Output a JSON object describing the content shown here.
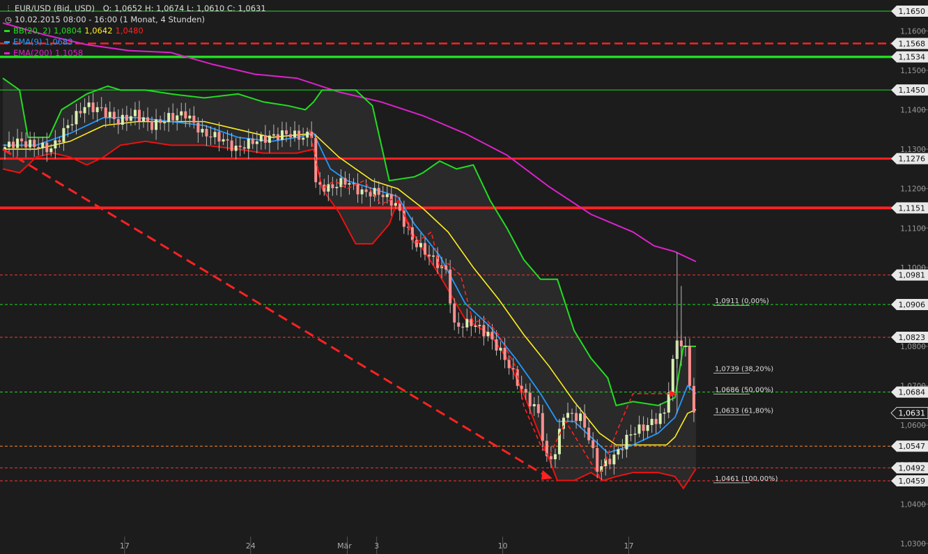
{
  "header": {
    "symbol": "EUR/USD (Bid, USD)",
    "ohlc": "O: 1,0652  H: 1,0674  L: 1,0610  C: 1,0631",
    "period": "10.02.2015 08:00 - 16:00 (1 Monat, 4 Stunden)",
    "indicators": [
      {
        "name": "BB(20, 2)",
        "color": "#22dd22",
        "values": [
          {
            "text": "1,0804",
            "color": "#22dd22"
          },
          {
            "text": "1,0642",
            "color": "#ffee22"
          },
          {
            "text": "1,0480",
            "color": "#ff2222"
          }
        ]
      },
      {
        "name": "EMA(9)",
        "color": "#2299ff",
        "values": [
          {
            "text": "1,0683",
            "color": "#2299ff"
          }
        ]
      },
      {
        "name": "EMA(200)",
        "color": "#dd22cc",
        "values": [
          {
            "text": "1,1058",
            "color": "#dd22cc"
          }
        ]
      }
    ]
  },
  "chart_data": {
    "type": "line",
    "subtype": "candlestick-with-indicators",
    "y_range": [
      1.03,
      1.165
    ],
    "y_ticks": [
      {
        "v": 1.16,
        "label": "1,1600"
      },
      {
        "v": 1.15,
        "label": "1,1500"
      },
      {
        "v": 1.14,
        "label": "1,1400"
      },
      {
        "v": 1.13,
        "label": "1,1300"
      },
      {
        "v": 1.12,
        "label": "1,1200"
      },
      {
        "v": 1.11,
        "label": "1,1100"
      },
      {
        "v": 1.1,
        "label": "1,1000"
      },
      {
        "v": 1.09,
        "label": "1,0900"
      },
      {
        "v": 1.08,
        "label": "1,0800"
      },
      {
        "v": 1.07,
        "label": "1,0700"
      },
      {
        "v": 1.06,
        "label": "1,0600"
      },
      {
        "v": 1.05,
        "label": "1,0500"
      },
      {
        "v": 1.04,
        "label": "1,0400"
      },
      {
        "v": 1.03,
        "label": "1,0300"
      }
    ],
    "x_ticks": [
      {
        "i": 29,
        "label": "17"
      },
      {
        "i": 59,
        "label": "24"
      },
      {
        "i": 82,
        "label": "Mär"
      },
      {
        "i": 89,
        "label": "3"
      },
      {
        "i": 119,
        "label": "10"
      },
      {
        "i": 149,
        "label": "17"
      }
    ],
    "n_bars": 165,
    "levels": [
      {
        "v": 1.165,
        "label": "1,1650",
        "color": "#22dd22",
        "style": "solid",
        "width": 1
      },
      {
        "v": 1.1568,
        "label": "1,1568",
        "color": "#ff2222",
        "style": "dash",
        "width": 2.5
      },
      {
        "v": 1.1534,
        "label": "1,1534",
        "color": "#22dd22",
        "style": "solid",
        "width": 3.5
      },
      {
        "v": 1.145,
        "label": "1,1450",
        "color": "#22dd22",
        "style": "solid",
        "width": 1
      },
      {
        "v": 1.1276,
        "label": "1,1276",
        "color": "#ff2222",
        "style": "solid",
        "width": 3
      },
      {
        "v": 1.1151,
        "label": "1,1151",
        "color": "#ff2222",
        "style": "solid",
        "width": 4
      },
      {
        "v": 1.0981,
        "label": "1,0981",
        "color": "#ff3333",
        "style": "dot",
        "width": 1
      },
      {
        "v": 1.0906,
        "label": "1,0906",
        "color": "#22dd22",
        "style": "dot",
        "width": 1
      },
      {
        "v": 1.0823,
        "label": "1,0823",
        "color": "#ff3333",
        "style": "dot",
        "width": 1
      },
      {
        "v": 1.0684,
        "label": "1,0684",
        "color": "#22dd22",
        "style": "dot",
        "width": 1
      },
      {
        "v": 1.0631,
        "label": "1,0631",
        "color": "#ffffff",
        "style": "none",
        "width": 0
      },
      {
        "v": 1.0547,
        "label": "1,0547",
        "color": "#ff8833",
        "style": "dot",
        "width": 1
      },
      {
        "v": 1.0492,
        "label": "1,0492",
        "color": "#ff3333",
        "style": "dot",
        "width": 1
      },
      {
        "v": 1.0459,
        "label": "1,0459",
        "color": "#ff3333",
        "style": "dot",
        "width": 1
      }
    ],
    "fib": [
      {
        "v": 1.0911,
        "label": "1,0911 (0,00%)"
      },
      {
        "v": 1.0739,
        "label": "1,0739 (38,20%)"
      },
      {
        "v": 1.0686,
        "label": "1,0686 (50,00%)"
      },
      {
        "v": 1.0633,
        "label": "1,0633 (61,80%)"
      },
      {
        "v": 1.0461,
        "label": "1,0461 (100,00%)"
      }
    ],
    "close": [
      [
        0,
        1.13
      ],
      [
        4,
        1.132
      ],
      [
        8,
        1.131
      ],
      [
        12,
        1.13
      ],
      [
        16,
        1.136
      ],
      [
        20,
        1.141
      ],
      [
        24,
        1.14
      ],
      [
        28,
        1.137
      ],
      [
        32,
        1.139
      ],
      [
        36,
        1.136
      ],
      [
        40,
        1.138
      ],
      [
        44,
        1.139
      ],
      [
        48,
        1.134
      ],
      [
        52,
        1.133
      ],
      [
        56,
        1.13
      ],
      [
        60,
        1.132
      ],
      [
        64,
        1.133
      ],
      [
        68,
        1.134
      ],
      [
        72,
        1.133
      ],
      [
        74,
        1.134
      ],
      [
        75,
        1.121
      ],
      [
        78,
        1.12
      ],
      [
        82,
        1.122
      ],
      [
        86,
        1.119
      ],
      [
        90,
        1.119
      ],
      [
        94,
        1.116
      ],
      [
        98,
        1.107
      ],
      [
        102,
        1.103
      ],
      [
        106,
        1.099
      ],
      [
        108,
        1.085
      ],
      [
        112,
        1.086
      ],
      [
        116,
        1.083
      ],
      [
        120,
        1.077
      ],
      [
        124,
        1.069
      ],
      [
        128,
        1.063
      ],
      [
        130,
        1.051
      ],
      [
        132,
        1.053
      ],
      [
        134,
        1.063
      ],
      [
        138,
        1.062
      ],
      [
        140,
        1.057
      ],
      [
        142,
        1.049
      ],
      [
        146,
        1.052
      ],
      [
        150,
        1.058
      ],
      [
        154,
        1.06
      ],
      [
        158,
        1.063
      ],
      [
        161,
        1.082
      ],
      [
        163,
        1.079
      ],
      [
        165,
        1.063
      ]
    ],
    "ema9": [
      [
        0,
        1.131
      ],
      [
        8,
        1.131
      ],
      [
        16,
        1.134
      ],
      [
        24,
        1.138
      ],
      [
        32,
        1.138
      ],
      [
        40,
        1.137
      ],
      [
        48,
        1.136
      ],
      [
        56,
        1.133
      ],
      [
        64,
        1.132
      ],
      [
        70,
        1.133
      ],
      [
        74,
        1.134
      ],
      [
        78,
        1.125
      ],
      [
        82,
        1.122
      ],
      [
        88,
        1.12
      ],
      [
        94,
        1.118
      ],
      [
        98,
        1.111
      ],
      [
        104,
        1.103
      ],
      [
        110,
        1.091
      ],
      [
        116,
        1.085
      ],
      [
        122,
        1.077
      ],
      [
        128,
        1.068
      ],
      [
        132,
        1.061
      ],
      [
        136,
        1.061
      ],
      [
        140,
        1.057
      ],
      [
        144,
        1.053
      ],
      [
        150,
        1.055
      ],
      [
        156,
        1.058
      ],
      [
        160,
        1.062
      ],
      [
        163,
        1.07
      ],
      [
        165,
        1.068
      ]
    ],
    "bb_mid": [
      [
        0,
        1.13
      ],
      [
        8,
        1.13
      ],
      [
        16,
        1.132
      ],
      [
        24,
        1.136
      ],
      [
        32,
        1.137
      ],
      [
        40,
        1.137
      ],
      [
        48,
        1.137
      ],
      [
        56,
        1.135
      ],
      [
        64,
        1.133
      ],
      [
        74,
        1.134
      ],
      [
        80,
        1.128
      ],
      [
        88,
        1.122
      ],
      [
        94,
        1.12
      ],
      [
        100,
        1.115
      ],
      [
        106,
        1.109
      ],
      [
        112,
        1.1
      ],
      [
        118,
        1.092
      ],
      [
        124,
        1.083
      ],
      [
        130,
        1.075
      ],
      [
        136,
        1.066
      ],
      [
        142,
        1.058
      ],
      [
        146,
        1.055
      ],
      [
        152,
        1.055
      ],
      [
        158,
        1.055
      ],
      [
        160,
        1.057
      ],
      [
        163,
        1.063
      ],
      [
        165,
        1.064
      ]
    ],
    "bb_up": [
      [
        0,
        1.148
      ],
      [
        4,
        1.145
      ],
      [
        6,
        1.133
      ],
      [
        8,
        1.133
      ],
      [
        11,
        1.133
      ],
      [
        14,
        1.14
      ],
      [
        20,
        1.144
      ],
      [
        25,
        1.146
      ],
      [
        28,
        1.145
      ],
      [
        34,
        1.145
      ],
      [
        40,
        1.144
      ],
      [
        48,
        1.143
      ],
      [
        56,
        1.144
      ],
      [
        62,
        1.142
      ],
      [
        68,
        1.141
      ],
      [
        72,
        1.14
      ],
      [
        74,
        1.142
      ],
      [
        76,
        1.145
      ],
      [
        80,
        1.145
      ],
      [
        84,
        1.145
      ],
      [
        88,
        1.141
      ],
      [
        92,
        1.122
      ],
      [
        98,
        1.123
      ],
      [
        100,
        1.124
      ],
      [
        104,
        1.127
      ],
      [
        108,
        1.125
      ],
      [
        112,
        1.126
      ],
      [
        116,
        1.117
      ],
      [
        120,
        1.11
      ],
      [
        124,
        1.102
      ],
      [
        128,
        1.097
      ],
      [
        132,
        1.097
      ],
      [
        136,
        1.084
      ],
      [
        140,
        1.077
      ],
      [
        144,
        1.072
      ],
      [
        146,
        1.065
      ],
      [
        150,
        1.066
      ],
      [
        156,
        1.065
      ],
      [
        160,
        1.067
      ],
      [
        162,
        1.08
      ],
      [
        165,
        1.08
      ]
    ],
    "bb_lo": [
      [
        0,
        1.125
      ],
      [
        4,
        1.124
      ],
      [
        8,
        1.128
      ],
      [
        12,
        1.129
      ],
      [
        16,
        1.128
      ],
      [
        20,
        1.126
      ],
      [
        24,
        1.128
      ],
      [
        28,
        1.131
      ],
      [
        34,
        1.132
      ],
      [
        40,
        1.131
      ],
      [
        48,
        1.131
      ],
      [
        56,
        1.13
      ],
      [
        62,
        1.129
      ],
      [
        70,
        1.129
      ],
      [
        74,
        1.13
      ],
      [
        76,
        1.12
      ],
      [
        80,
        1.114
      ],
      [
        84,
        1.106
      ],
      [
        88,
        1.106
      ],
      [
        92,
        1.111
      ],
      [
        94,
        1.117
      ],
      [
        98,
        1.108
      ],
      [
        104,
        1.098
      ],
      [
        110,
        1.087
      ],
      [
        116,
        1.083
      ],
      [
        120,
        1.077
      ],
      [
        124,
        1.068
      ],
      [
        128,
        1.057
      ],
      [
        132,
        1.046
      ],
      [
        136,
        1.046
      ],
      [
        140,
        1.048
      ],
      [
        143,
        1.046
      ],
      [
        146,
        1.047
      ],
      [
        150,
        1.048
      ],
      [
        156,
        1.048
      ],
      [
        160,
        1.047
      ],
      [
        162,
        1.044
      ],
      [
        165,
        1.049
      ]
    ],
    "ema200": [
      [
        0,
        1.162
      ],
      [
        10,
        1.159
      ],
      [
        20,
        1.1565
      ],
      [
        30,
        1.155
      ],
      [
        40,
        1.1545
      ],
      [
        50,
        1.1515
      ],
      [
        60,
        1.149
      ],
      [
        70,
        1.148
      ],
      [
        80,
        1.1445
      ],
      [
        90,
        1.142
      ],
      [
        100,
        1.1385
      ],
      [
        110,
        1.134
      ],
      [
        120,
        1.1285
      ],
      [
        130,
        1.1205
      ],
      [
        140,
        1.1135
      ],
      [
        150,
        1.109
      ],
      [
        155,
        1.1055
      ],
      [
        160,
        1.104
      ],
      [
        165,
        1.1015
      ]
    ],
    "red_dash": [
      [
        0,
        1.13
      ],
      [
        130,
        1.0467
      ]
    ],
    "zigzag": [
      [
        73,
        1.135
      ],
      [
        76,
        1.12
      ],
      [
        79,
        1.122
      ],
      [
        82,
        1.12
      ],
      [
        86,
        1.122
      ],
      [
        90,
        1.116
      ],
      [
        94,
        1.118
      ],
      [
        98,
        1.106
      ],
      [
        102,
        1.109
      ],
      [
        104,
        1.1
      ],
      [
        106,
        1.101
      ],
      [
        109,
        1.098
      ],
      [
        112,
        1.086
      ],
      [
        115,
        1.087
      ],
      [
        118,
        1.083
      ],
      [
        122,
        1.075
      ],
      [
        124,
        1.065
      ],
      [
        128,
        1.055
      ],
      [
        130,
        1.052
      ],
      [
        134,
        1.061
      ],
      [
        138,
        1.054
      ],
      [
        142,
        1.047
      ],
      [
        146,
        1.058
      ],
      [
        150,
        1.068
      ],
      [
        160,
        1.068
      ]
    ]
  }
}
